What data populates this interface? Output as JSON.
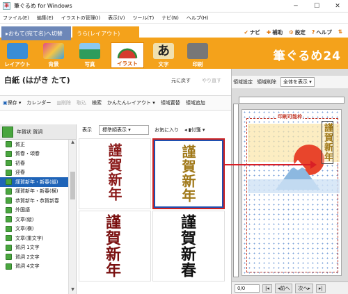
{
  "window": {
    "title": "筆ぐるめ for Windows",
    "controls": [
      "─",
      "☐",
      "✕"
    ]
  },
  "menu": [
    "ファイル(E)",
    "編集(E)",
    "イラストの管理(I)",
    "表示(V)",
    "ツール(T)",
    "ナビ(N)",
    "ヘルプ(H)"
  ],
  "mode_tabs": {
    "omote": "▸おもて(宛て名)へ切替",
    "ura": "うら(レイアウト)"
  },
  "tools": [
    {
      "icon": "✔",
      "label": "ナビ"
    },
    {
      "icon": "✚",
      "label": "補助"
    },
    {
      "icon": "⚙",
      "label": "設定"
    },
    {
      "icon": "?",
      "label": "ヘルプ"
    },
    {
      "icon": "⇅",
      "label": ""
    }
  ],
  "ribbon": {
    "buttons": [
      {
        "label": "レイアウト",
        "color": "#3a8dd6"
      },
      {
        "label": "背景",
        "color": "#d95b8a"
      },
      {
        "label": "写真",
        "color": "#2e9c5c"
      },
      {
        "label": "イラスト",
        "color": "#d63b2f",
        "selected": true
      },
      {
        "label": "文字",
        "color": "#f0e0b0"
      },
      {
        "label": "印刷",
        "color": "#777777"
      }
    ],
    "brand": "筆ぐるめ24"
  },
  "paper": {
    "title": "白紙 (はがき たて)",
    "undo": "元に戻す",
    "redo": "やり直す"
  },
  "toolbar": {
    "save": "保存",
    "calendar": "カレンダー",
    "delete": "削除",
    "import": "取込",
    "search": "検索",
    "easy_layout": "かんたんレイアウト",
    "place": "領域置替",
    "add": "領域追加"
  },
  "sidebar": {
    "category": "年賀状 賀詞",
    "items": [
      "賀正",
      "賀春・頌春",
      "初春",
      "迎春",
      "謹賀新年・新春(縦)",
      "謹賀新年・新春(横)",
      "恭賀新年・恭賀新春",
      "外国語",
      "文章(縦)",
      "文章(横)",
      "文章(重文字)",
      "賀詞 1文字",
      "賀詞 2文字",
      "賀詞 4文字"
    ],
    "selected_index": 4
  },
  "gallery": {
    "view_label": "表示",
    "sort": "標準順表示",
    "favorites": "お気に入り",
    "filter": "付箋",
    "thumbs": [
      {
        "text": "謹賀新年",
        "color": "#8b1a1a"
      },
      {
        "text": "謹賀新年",
        "color": "#a07818"
      },
      {
        "text": "謹賀新年",
        "color": "#7a1010"
      },
      {
        "text": "謹賀新春",
        "color": "#111111"
      }
    ]
  },
  "preview": {
    "area_set": "領域設定",
    "area_delete": "領域削除",
    "zoom": "全体を表示",
    "print_area": "印刷可能枠",
    "card_text": "謹賀新年",
    "page": "0/0",
    "prev": "前へ",
    "next": "次へ"
  }
}
